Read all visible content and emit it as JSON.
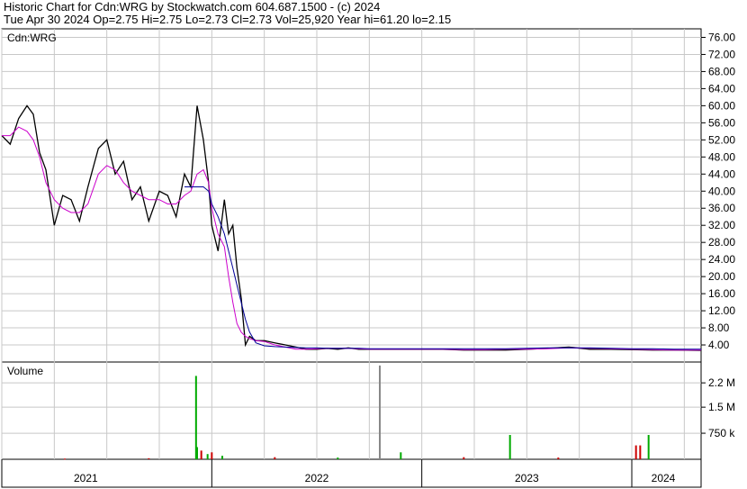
{
  "header": {
    "line1": "Historic Chart for Cdn:WRG by Stockwatch.com 604.687.1500 - (c) 2024",
    "line2": "Tue Apr 30 2024   Op=2.75  Hi=2.75  Lo=2.73  Cl=2.73  Vol=25,920  Year hi=61.20  lo=2.15"
  },
  "chart_data": [
    {
      "type": "line",
      "title": "Cdn:WRG",
      "ylim": [
        0,
        78
      ],
      "yticks": [
        "76.00",
        "72.00",
        "68.00",
        "64.00",
        "60.00",
        "56.00",
        "52.00",
        "48.00",
        "44.00",
        "40.00",
        "36.00",
        "32.00",
        "28.00",
        "24.00",
        "20.00",
        "16.00",
        "12.00",
        "8.00",
        "4.00"
      ],
      "x": [
        2021.0,
        2021.04,
        2021.08,
        2021.12,
        2021.15,
        2021.18,
        2021.21,
        2021.25,
        2021.29,
        2021.33,
        2021.37,
        2021.41,
        2021.46,
        2021.5,
        2021.54,
        2021.58,
        2021.62,
        2021.66,
        2021.7,
        2021.75,
        2021.79,
        2021.83,
        2021.87,
        2021.9,
        2021.93,
        2021.96,
        2021.985,
        2022.0,
        2022.03,
        2022.06,
        2022.08,
        2022.1,
        2022.12,
        2022.14,
        2022.16,
        2022.18,
        2022.21,
        2022.25,
        2022.3,
        2022.35,
        2022.4,
        2022.45,
        2022.5,
        2022.55,
        2022.6,
        2022.65,
        2022.7,
        2022.75,
        2022.8,
        2022.85,
        2022.9,
        2022.95,
        2023.0,
        2023.1,
        2023.2,
        2023.3,
        2023.4,
        2023.5,
        2023.6,
        2023.7,
        2023.8,
        2023.9,
        2024.0,
        2024.1,
        2024.2,
        2024.33
      ],
      "series": [
        {
          "values": [
            53,
            51,
            57,
            60,
            58,
            49,
            45,
            32,
            39,
            38,
            33,
            41,
            50,
            52,
            44,
            47,
            38,
            41,
            33,
            40,
            39,
            34,
            44,
            41,
            60,
            52,
            42,
            32,
            26,
            38,
            30,
            32,
            22,
            15,
            4,
            6,
            5,
            5,
            4.5,
            4,
            3.5,
            3,
            3,
            3.2,
            3,
            3.3,
            3,
            3,
            3,
            3,
            3,
            3,
            3,
            3,
            2.8,
            2.8,
            2.8,
            3,
            3.2,
            3.5,
            3,
            3,
            2.9,
            2.8,
            2.8,
            2.73
          ]
        },
        {
          "values": [
            53,
            53,
            55,
            54,
            52,
            48,
            42,
            38,
            36,
            35,
            35,
            37,
            44,
            46,
            45,
            42,
            40,
            39,
            38,
            38,
            37,
            37,
            39,
            40,
            44,
            45,
            42,
            36,
            30,
            27,
            20,
            14,
            9,
            7,
            6,
            5.5,
            5,
            4.8,
            4,
            3.5,
            3,
            3,
            3.1,
            3.2,
            3.2,
            3.2,
            3.1,
            3,
            3,
            3,
            3,
            3,
            3,
            3,
            2.9,
            2.9,
            3,
            3,
            3.1,
            3.3,
            3.2,
            3.1,
            3,
            2.9,
            2.8,
            2.8
          ]
        },
        {
          "values": [
            null,
            null,
            null,
            null,
            null,
            null,
            null,
            null,
            null,
            null,
            null,
            null,
            null,
            null,
            null,
            null,
            null,
            null,
            null,
            null,
            null,
            null,
            41,
            41,
            41,
            41,
            40,
            37,
            34,
            30,
            26,
            22,
            18,
            14,
            10,
            7,
            4.5,
            3.8,
            3.6,
            3.5,
            3.4,
            3.3,
            3.3,
            3.2,
            3.2,
            3.2,
            3.2,
            3.1,
            3.1,
            3.1,
            3.1,
            3.1,
            3.1,
            3.1,
            3.1,
            3.1,
            3.1,
            3.2,
            3.3,
            3.3,
            3.3,
            3.2,
            3.1,
            3.1,
            3.0,
            3.0
          ]
        }
      ],
      "series_colors": [
        "#000000",
        "#cc00cc",
        "#000099"
      ]
    },
    {
      "type": "bar",
      "title": "Volume",
      "ylim": [
        0,
        2800000
      ],
      "yticks": [
        "2.2 M",
        "1.5 M",
        "750 k"
      ],
      "xticks": [
        "2021",
        "2022",
        "2023",
        "2024"
      ],
      "bars": [
        {
          "x": 2021.3,
          "value": 20000,
          "color": "red"
        },
        {
          "x": 2021.7,
          "value": 30000,
          "color": "red"
        },
        {
          "x": 2021.925,
          "value": 2400000,
          "color": "green"
        },
        {
          "x": 2021.93,
          "value": 350000,
          "color": "green"
        },
        {
          "x": 2021.95,
          "value": 250000,
          "color": "red"
        },
        {
          "x": 2021.98,
          "value": 150000,
          "color": "green"
        },
        {
          "x": 2022.0,
          "value": 200000,
          "color": "red"
        },
        {
          "x": 2022.05,
          "value": 100000,
          "color": "green"
        },
        {
          "x": 2022.3,
          "value": 60000,
          "color": "red"
        },
        {
          "x": 2022.6,
          "value": 50000,
          "color": "green"
        },
        {
          "x": 2022.8,
          "value": 2700000,
          "color": "grey"
        },
        {
          "x": 2022.9,
          "value": 200000,
          "color": "green"
        },
        {
          "x": 2023.2,
          "value": 60000,
          "color": "red"
        },
        {
          "x": 2023.42,
          "value": 700000,
          "color": "green"
        },
        {
          "x": 2023.65,
          "value": 50000,
          "color": "red"
        },
        {
          "x": 2024.02,
          "value": 400000,
          "color": "red"
        },
        {
          "x": 2024.04,
          "value": 400000,
          "color": "red"
        },
        {
          "x": 2024.08,
          "value": 700000,
          "color": "green"
        }
      ],
      "colors": {
        "green": "#00aa00",
        "red": "#cc0000",
        "grey": "#888888"
      }
    }
  ]
}
